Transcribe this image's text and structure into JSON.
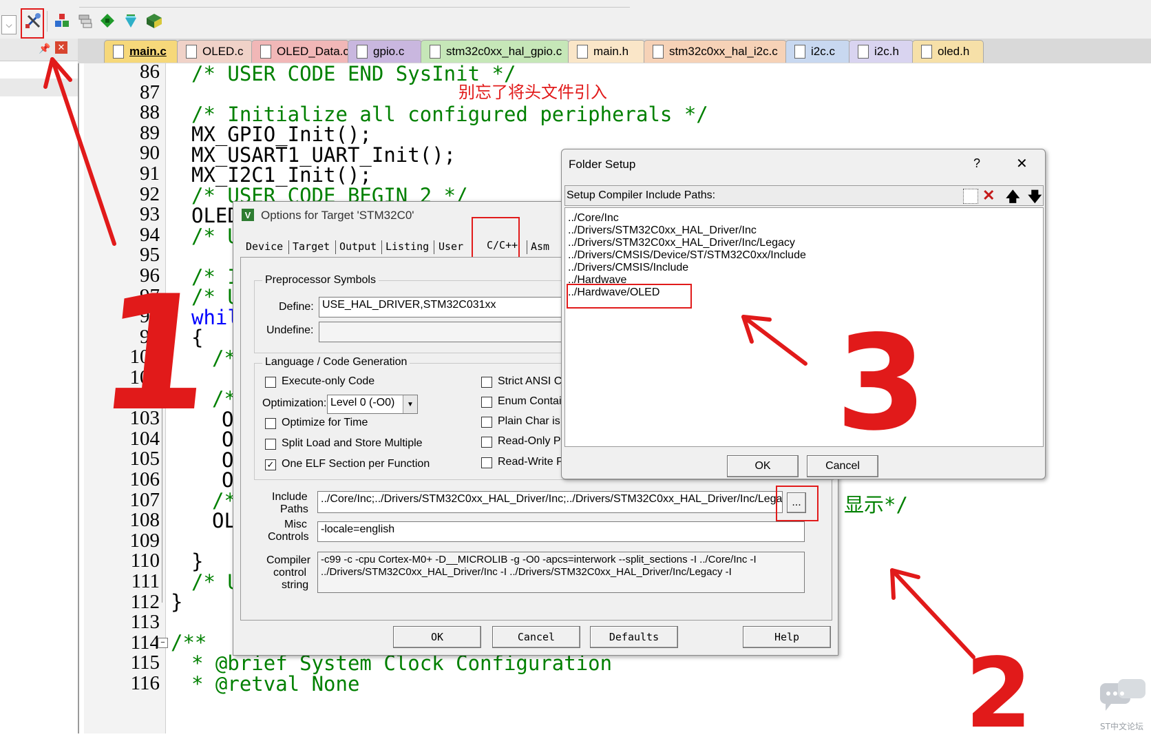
{
  "editor": {
    "tabs": [
      {
        "label": "main.c",
        "color": "#f6d87a"
      },
      {
        "label": "OLED.c",
        "color": "#f0d2c8"
      },
      {
        "label": "OLED_Data.c",
        "color": "#f1b7b7"
      },
      {
        "label": "gpio.c",
        "color": "#c9b7df"
      },
      {
        "label": "stm32c0xx_hal_gpio.c",
        "color": "#c6e7b8"
      },
      {
        "label": "main.h",
        "color": "#fae6c8"
      },
      {
        "label": "stm32c0xx_hal_i2c.c",
        "color": "#f6d2b7"
      },
      {
        "label": "i2c.c",
        "color": "#c8d8f0"
      },
      {
        "label": "i2c.h",
        "color": "#d9d4f0"
      },
      {
        "label": "oled.h",
        "color": "#f6e0a8"
      }
    ],
    "line_numbers": [
      "86",
      "87",
      "88",
      "89",
      "90",
      "91",
      "92",
      "93",
      "94",
      "95",
      "96",
      "97",
      "98",
      "99",
      "100",
      "101",
      "102",
      "103",
      "104",
      "105",
      "106",
      "107",
      "108",
      "109",
      "110",
      "111",
      "112",
      "113",
      "114",
      "115",
      "116"
    ],
    "code": {
      "l86": "/* USER CODE END SysInit */",
      "l88": "/* Initialize all configured peripherals */",
      "l89": "MX_GPIO_Init();",
      "l90": "MX_USART1_UART_Init();",
      "l91": "MX_I2C1_Init();",
      "l92": "/* USER CODE BEGIN 2 */",
      "l93": "OLED",
      "l94": "/* U",
      "l96": "/* I",
      "l97": "/* U",
      "l98": "whil",
      "l99": "{",
      "l100": "/*",
      "l102": "/*",
      "l103": "O",
      "l104": "O",
      "l105": "O",
      "l106": "O",
      "l107": "/*",
      "l108": "OL",
      "l110": "}",
      "l111": "/* U",
      "l112": "}",
      "l114": "/**",
      "l115": "* @brief System Clock Configuration",
      "l116": "* @retval None",
      "l107_tail": "显示*/"
    }
  },
  "annotations": {
    "note": "别忘了将头文件引入",
    "num1": "1",
    "num2": "2",
    "num3": "3",
    "color": "#e11a1a"
  },
  "options_dialog": {
    "title": "Options for Target 'STM32C0'",
    "tabs": [
      "Device",
      "Target",
      "Output",
      "Listing",
      "User",
      "C/C++",
      "Asm"
    ],
    "preprocessor": {
      "group_label": "Preprocessor Symbols",
      "define_label": "Define:",
      "define_value": "USE_HAL_DRIVER,STM32C031xx",
      "undefine_label": "Undefine:",
      "undefine_value": ""
    },
    "language": {
      "group_label": "Language / Code Generation",
      "execute_only": "Execute-only Code",
      "optimization_label": "Optimization:",
      "optimization_value": "Level 0 (-O0)",
      "optimize_time": "Optimize for Time",
      "split_load": "Split Load and Store Multiple",
      "one_elf": "One ELF Section per Function",
      "strict_ansi": "Strict ANSI C",
      "enum_container": "Enum Contain",
      "plain_char": "Plain Char is S",
      "read_only": "Read-Only Po",
      "read_write": "Read-Write P"
    },
    "include_label_1": "Include",
    "include_label_2": "Paths",
    "include_value": "../Core/Inc;../Drivers/STM32C0xx_HAL_Driver/Inc;../Drivers/STM32C0xx_HAL_Driver/Inc/Legacy;",
    "browse_label": "...",
    "misc_label_1": "Misc",
    "misc_label_2": "Controls",
    "misc_value": "-locale=english",
    "compiler_label_1": "Compiler",
    "compiler_label_2": "control",
    "compiler_label_3": "string",
    "compiler_line_1": "-c99 -c -cpu Cortex-M0+ -D__MICROLIB -g -O0 -apcs=interwork --split_sections -I ../Core/Inc -I",
    "compiler_line_2": "../Drivers/STM32C0xx_HAL_Driver/Inc -I ../Drivers/STM32C0xx_HAL_Driver/Inc/Legacy -I",
    "buttons": {
      "ok": "OK",
      "cancel": "Cancel",
      "defaults": "Defaults",
      "help": "Help"
    }
  },
  "folder_dialog": {
    "title": "Folder Setup",
    "help": "?",
    "close": "✕",
    "header": "Setup Compiler Include Paths:",
    "paths": [
      "../Core/Inc",
      "../Drivers/STM32C0xx_HAL_Driver/Inc",
      "../Drivers/STM32C0xx_HAL_Driver/Inc/Legacy",
      "../Drivers/CMSIS/Device/ST/STM32C0xx/Include",
      "../Drivers/CMSIS/Include",
      "../Hardwave",
      "../Hardwave/OLED"
    ],
    "ok": "OK",
    "cancel": "Cancel"
  },
  "watermark": {
    "text": "ST中文论坛"
  }
}
